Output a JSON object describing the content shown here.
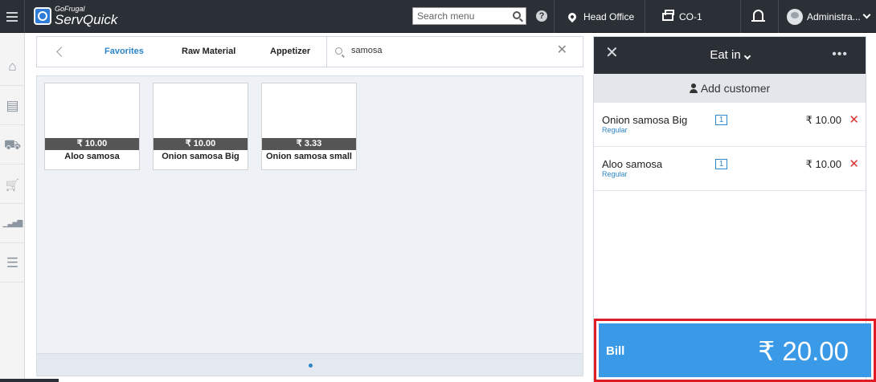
{
  "topbar": {
    "brand_small": "GoFrugal",
    "brand_name": "ServQuick",
    "search_placeholder": "Search menu",
    "help_glyph": "?",
    "location": "Head Office",
    "counter": "CO-1",
    "user": "Administra..."
  },
  "leftnav": [
    {
      "icon": "home-icon",
      "glyph": "⌂"
    },
    {
      "icon": "catalog-icon",
      "glyph": "▤"
    },
    {
      "icon": "inventory-icon",
      "glyph": "⛟"
    },
    {
      "icon": "cart-icon",
      "glyph": "🛒"
    },
    {
      "icon": "reports-icon",
      "glyph": "▁▃▅▇"
    },
    {
      "icon": "settings-sliders-icon",
      "glyph": "☰"
    }
  ],
  "categories": {
    "tabs": [
      "Favorites",
      "Raw Material",
      "Appetizer"
    ],
    "active_tab": "Favorites",
    "search_value": "samosa",
    "clear_glyph": "✕"
  },
  "products": [
    {
      "name": "Aloo samosa",
      "price": "₹ 10.00"
    },
    {
      "name": "Onion samosa Big",
      "price": "₹ 10.00"
    },
    {
      "name": "Onion samosa small",
      "price": "₹ 3.33"
    }
  ],
  "order": {
    "close_glyph": "✕",
    "mode": "Eat in",
    "more_glyph": "•••",
    "add_customer": "Add customer",
    "lines": [
      {
        "name": "Onion samosa Big",
        "variant": "Regular",
        "qty": "1",
        "price": "₹ 10.00"
      },
      {
        "name": "Aloo samosa",
        "variant": "Regular",
        "qty": "1",
        "price": "₹ 10.00"
      }
    ],
    "remove_glyph": "✕",
    "bill_label": "Bill",
    "bill_total": "₹ 20.00"
  },
  "colors": {
    "topbar": "#2b3036",
    "accent": "#2d86c9",
    "bill_button": "#3b9ae7",
    "highlight_border": "#e01b24",
    "remove": "#d9342b"
  }
}
